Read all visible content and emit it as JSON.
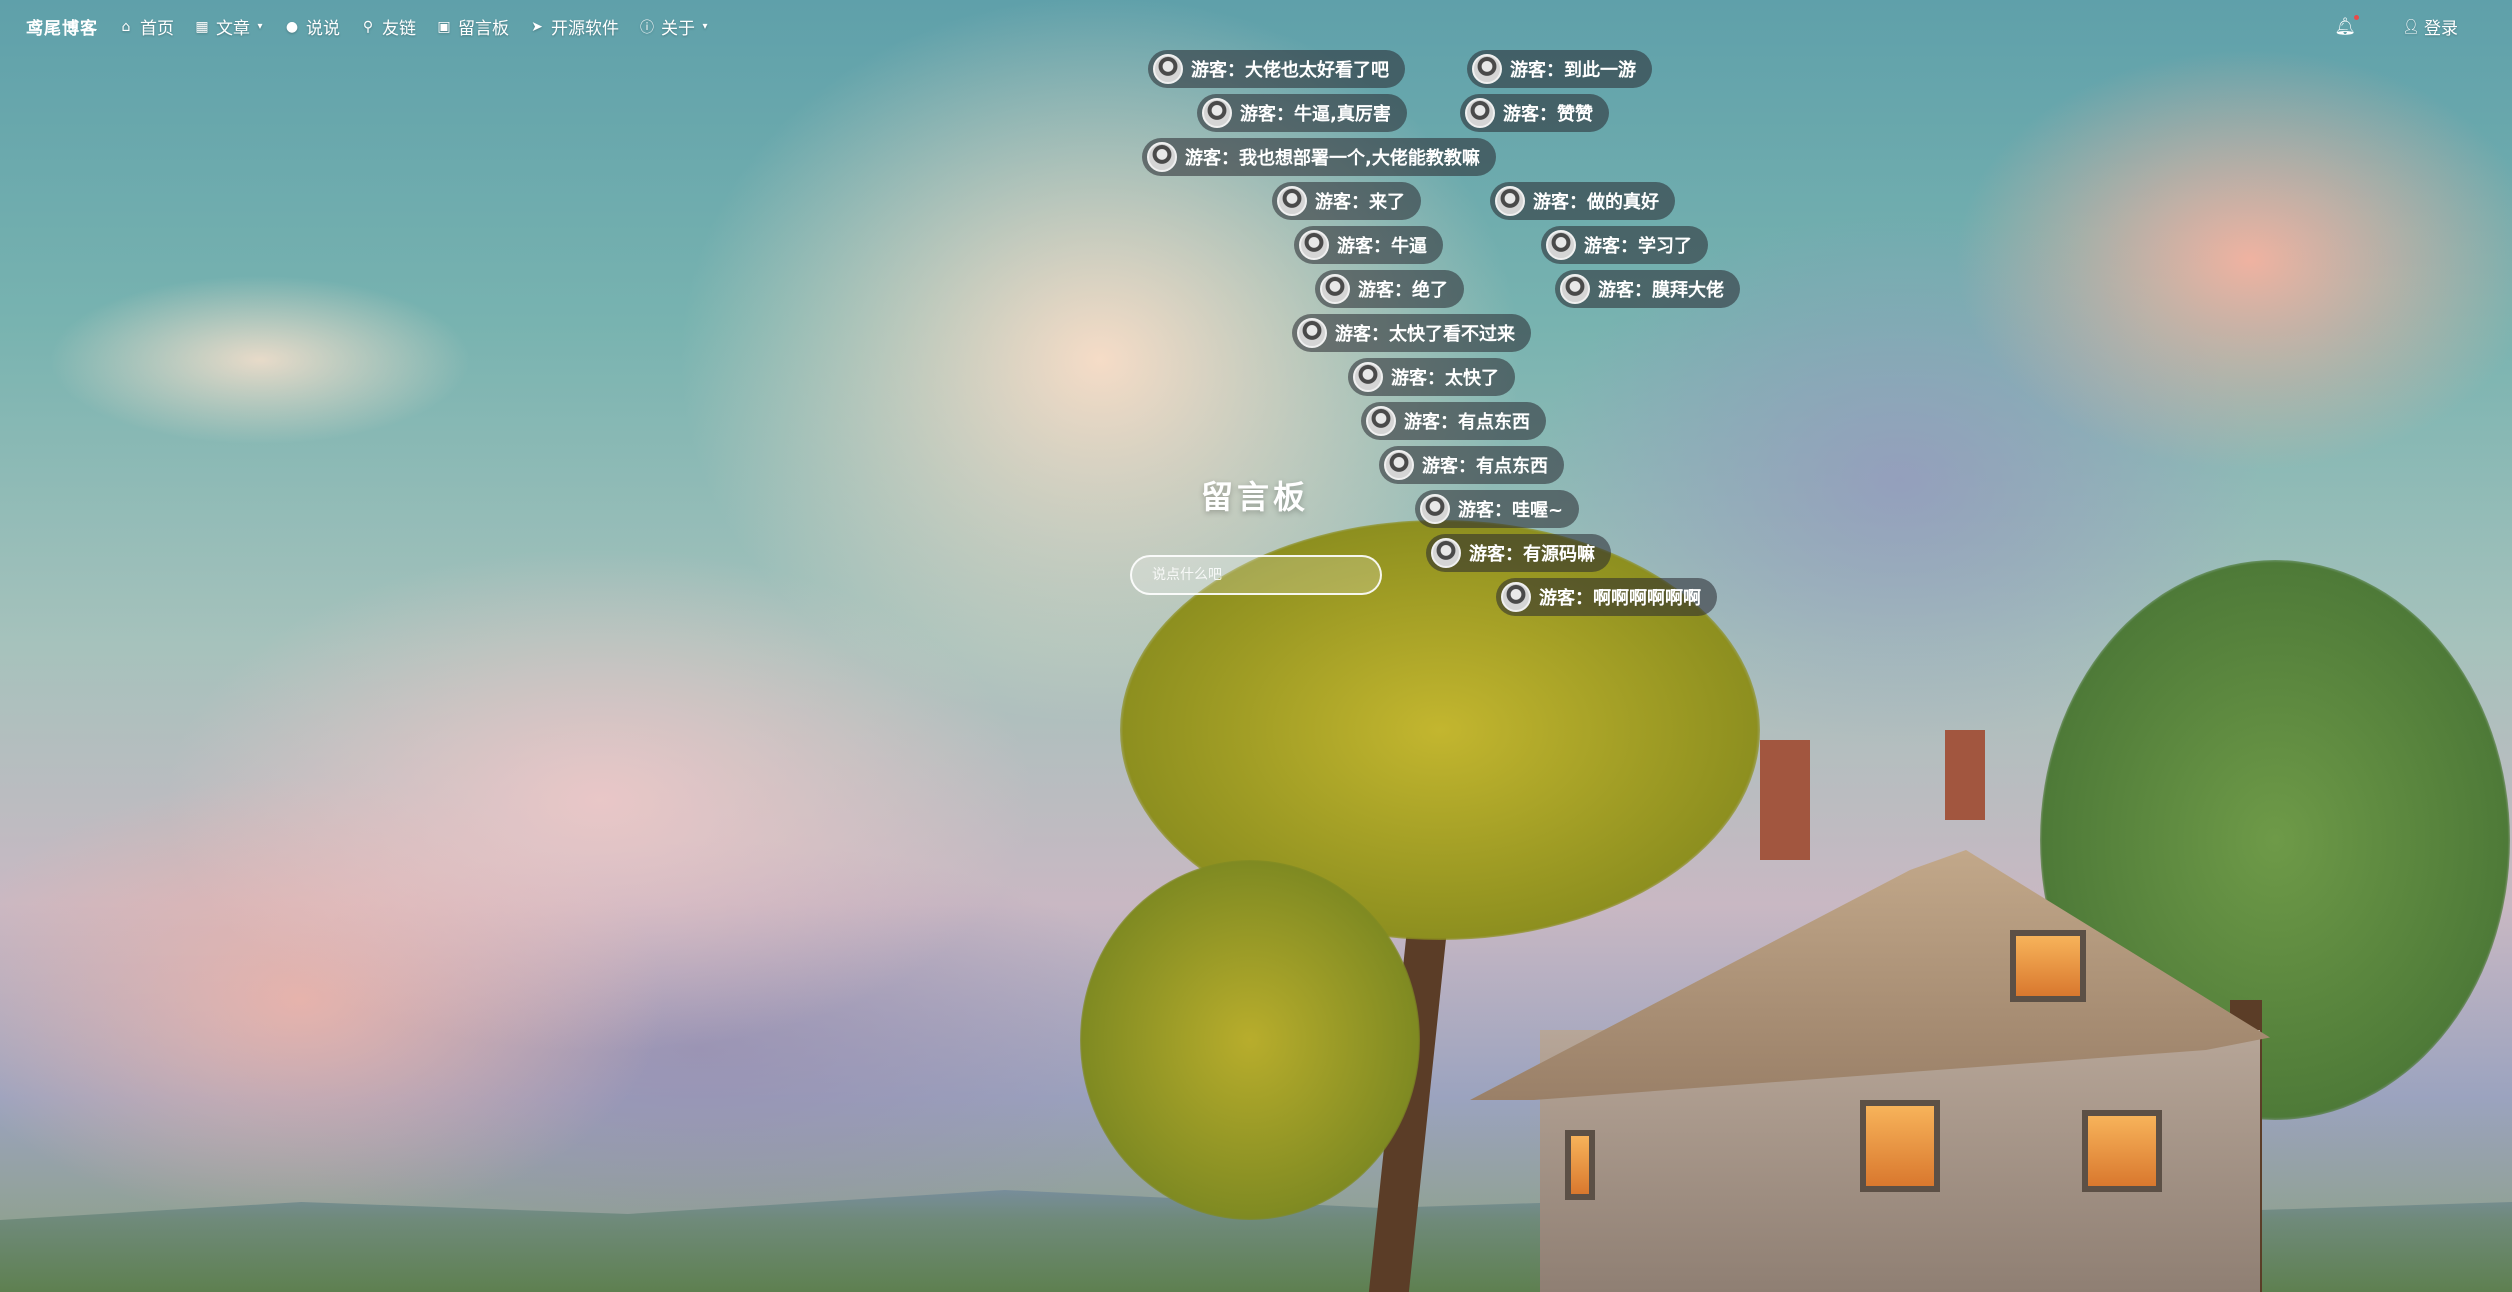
{
  "nav": {
    "brand": "鸢尾博客",
    "items": [
      {
        "label": "首页",
        "icon": "home-icon"
      },
      {
        "label": "文章",
        "icon": "grid-icon"
      },
      {
        "label": "说说",
        "icon": "chat-icon"
      },
      {
        "label": "友链",
        "icon": "link-icon"
      },
      {
        "label": "留言板",
        "icon": "message-board-icon"
      },
      {
        "label": "开源软件",
        "icon": "send-icon"
      },
      {
        "label": "关于",
        "icon": "info-icon"
      }
    ],
    "login_label": "登录"
  },
  "board": {
    "title": "留言板",
    "input_placeholder": "说点什么吧"
  },
  "messages": [
    "游客：大佬也太好看了吧",
    "游客：到此一游",
    "游客：牛逼,真厉害",
    "游客：赞赞",
    "游客：我也想部署一个,大佬能教教嘛",
    "游客：来了",
    "游客：做的真好",
    "游客：牛逼",
    "游客：学习了",
    "游客：绝了",
    "游客：膜拜大佬",
    "游客：太快了看不过来",
    "游客：太快了",
    "游客：有点东西",
    "游客：有点东西",
    "游客：哇喔~",
    "游客：有源码嘛",
    "游客：啊啊啊啊啊啊"
  ]
}
